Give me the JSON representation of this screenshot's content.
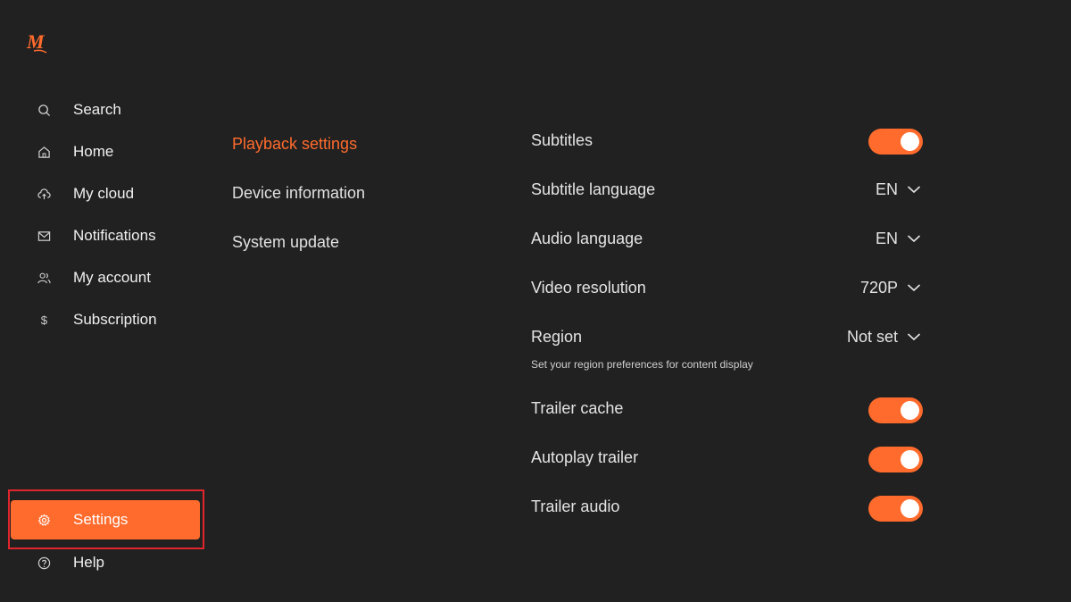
{
  "app": {
    "logo_text": "M",
    "accent_color": "#ff6b2c"
  },
  "sidebar": {
    "items": [
      {
        "label": "Search",
        "icon": "search-icon"
      },
      {
        "label": "Home",
        "icon": "home-icon"
      },
      {
        "label": "My cloud",
        "icon": "cloud-upload-icon"
      },
      {
        "label": "Notifications",
        "icon": "mail-icon"
      },
      {
        "label": "My account",
        "icon": "users-icon"
      },
      {
        "label": "Subscription",
        "icon": "dollar-icon"
      }
    ],
    "bottom_items": [
      {
        "label": "Settings",
        "icon": "gear-icon",
        "active": true
      },
      {
        "label": "Help",
        "icon": "help-icon"
      }
    ]
  },
  "categories": [
    {
      "label": "Playback settings",
      "active": true
    },
    {
      "label": "Device information"
    },
    {
      "label": "System update"
    }
  ],
  "settings": {
    "subtitles": {
      "label": "Subtitles",
      "on": true
    },
    "subtitle_language": {
      "label": "Subtitle language",
      "value": "EN"
    },
    "audio_language": {
      "label": "Audio language",
      "value": "EN"
    },
    "video_resolution": {
      "label": "Video resolution",
      "value": "720P"
    },
    "region": {
      "label": "Region",
      "value": "Not set",
      "description": "Set your region preferences for content display"
    },
    "trailer_cache": {
      "label": "Trailer cache",
      "on": true
    },
    "autoplay_trailer": {
      "label": "Autoplay trailer",
      "on": true
    },
    "trailer_audio": {
      "label": "Trailer audio",
      "on": true
    }
  }
}
